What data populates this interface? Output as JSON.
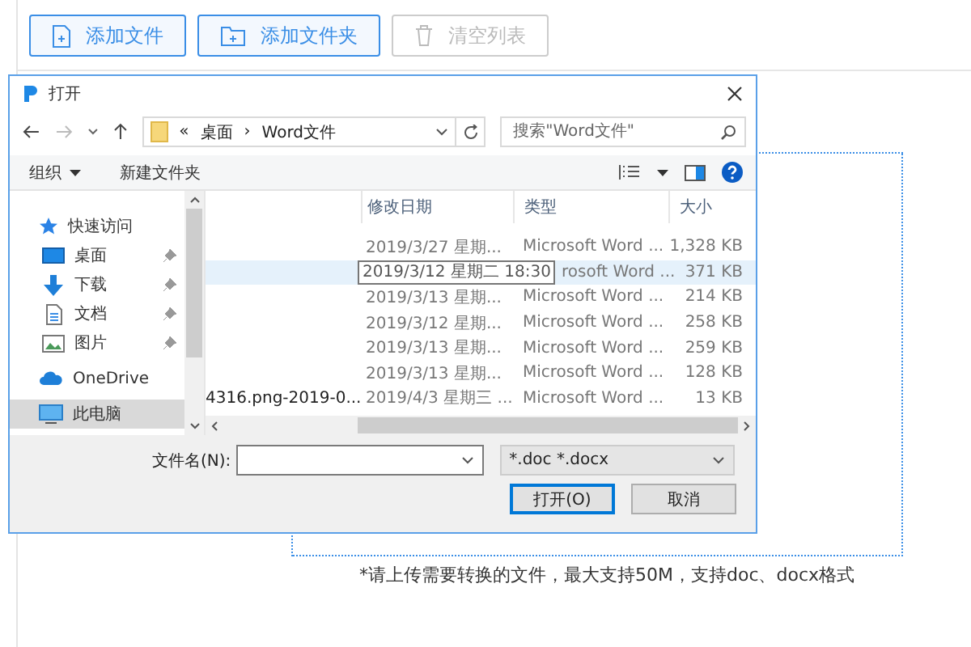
{
  "toolbar": {
    "buttons": [
      {
        "label": "添加文件",
        "kind": "file",
        "disabled": false
      },
      {
        "label": "添加文件夹",
        "kind": "folder",
        "disabled": false
      },
      {
        "label": "清空列表",
        "kind": "trash",
        "disabled": true
      }
    ]
  },
  "dialog": {
    "title": "打开",
    "address": [
      "«",
      "桌面",
      "›",
      "Word文件"
    ],
    "search": {
      "placeholder": "搜索\"Word文件\""
    },
    "commands": [
      {
        "label": "组织",
        "kind": "menu"
      },
      {
        "label": "新建文件夹",
        "kind": "plain"
      }
    ],
    "nav_items": [
      {
        "label": "快速访问",
        "kind": "star",
        "selected": false,
        "children": [
          {
            "label": "桌面",
            "kind": "desktop",
            "selected": false,
            "pinned": true
          },
          {
            "label": "下载",
            "kind": "download",
            "selected": false,
            "pinned": true
          },
          {
            "label": "文档",
            "kind": "document",
            "selected": false,
            "pinned": true
          },
          {
            "label": "图片",
            "kind": "picture",
            "selected": false,
            "pinned": true
          }
        ]
      },
      {
        "label": "OneDrive",
        "kind": "cloud",
        "selected": false
      },
      {
        "label": "此电脑",
        "kind": "computer",
        "selected": true
      }
    ],
    "columns": [
      "修改日期",
      "类型",
      "大小"
    ],
    "rows": [
      {
        "date": "2019/3/27 星期...",
        "type": "Microsoft Word ...",
        "size": "1,328 KB",
        "selected": false
      },
      {
        "tooltip": "2019/3/12 星期二 18:30",
        "type": "rosoft Word ...",
        "size": "371 KB",
        "selected": true
      },
      {
        "date": "2019/3/13 星期...",
        "type": "Microsoft Word ...",
        "size": "214 KB",
        "selected": false
      },
      {
        "date": "2019/3/12 星期...",
        "type": "Microsoft Word ...",
        "size": "258 KB",
        "selected": false
      },
      {
        "date": "2019/3/13 星期...",
        "type": "Microsoft Word ...",
        "size": "259 KB",
        "selected": false
      },
      {
        "date": "2019/3/13 星期...",
        "type": "Microsoft Word ...",
        "size": "128 KB",
        "selected": false
      },
      {
        "name": "4316.png-2019-0...",
        "date": "2019/4/3 星期三 ...",
        "type": "Microsoft Word ...",
        "size": "13 KB",
        "selected": false
      }
    ],
    "filename_label": "文件名(N):",
    "filter": "*.doc *.docx",
    "buttons": [
      {
        "label": "打开(O)",
        "default": true
      },
      {
        "label": "取消",
        "default": false
      }
    ]
  },
  "hint": "*请上传需要转换的文件，最大支持50M，支持doc、docx格式"
}
